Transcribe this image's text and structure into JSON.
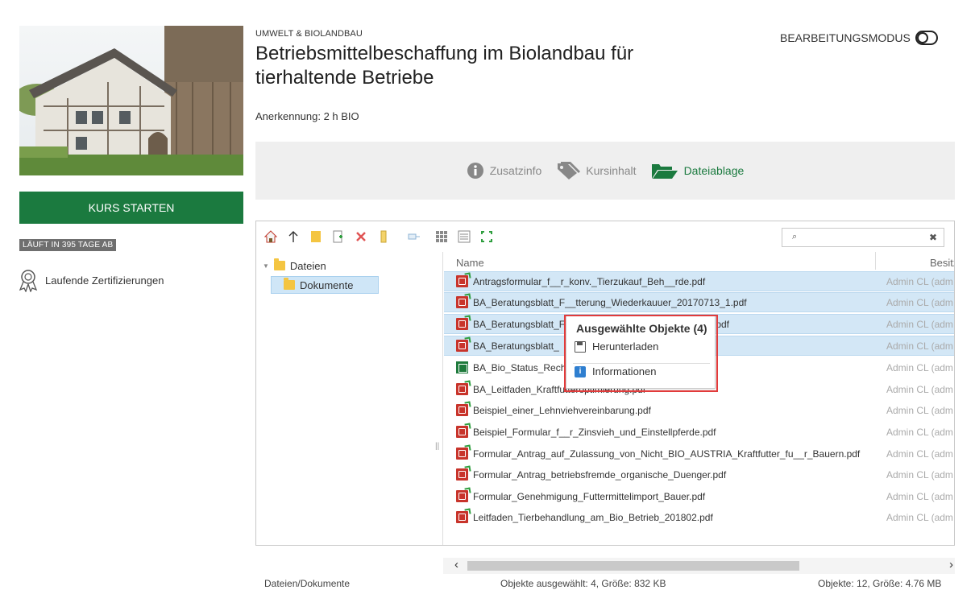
{
  "sidebar": {
    "start_button": "KURS STARTEN",
    "runs_badge": "LÄUFT IN 395 TAGE AB",
    "certifications_label": "Laufende Zertifizierungen"
  },
  "header": {
    "category": "UMWELT & BIOLANDBAU",
    "title": "Betriebsmittelbeschaffung im Biolandbau für tierhaltende Betriebe",
    "recognition": "Anerkennung: 2 h BIO",
    "edit_mode_label": "BEARBEITUNGSMODUS"
  },
  "tabs": [
    {
      "label": "Zusatzinfo",
      "icon": "info-circle-icon",
      "active": false
    },
    {
      "label": "Kursinhalt",
      "icon": "tags-icon",
      "active": false
    },
    {
      "label": "Dateiablage",
      "icon": "folder-open-icon",
      "active": true
    }
  ],
  "file_manager": {
    "search_placeholder": "",
    "tree": {
      "root": "Dateien",
      "child": "Dokumente"
    },
    "columns": {
      "name": "Name",
      "owner": "Besitz"
    },
    "files": [
      {
        "name": "Antragsformular_f__r_konv._Tierzukauf_Beh__rde.pdf",
        "owner": "Admin CL (adm",
        "type": "pdf",
        "selected": true
      },
      {
        "name": "BA_Beratungsblatt_F__tterung_Wiederkauuer_20170713_1.pdf",
        "owner": "Admin CL (adm",
        "type": "pdf",
        "selected": true
      },
      {
        "name": "BA_Beratungsblatt_F",
        "name_tail": ".pdf",
        "owner": "Admin CL (adm",
        "type": "pdf",
        "selected": true
      },
      {
        "name": "BA_Beratungsblatt_",
        "owner": "Admin CL (adm",
        "type": "pdf",
        "selected": true
      },
      {
        "name": "BA_Bio_Status_Rechr",
        "owner": "Admin CL (adm",
        "type": "xls",
        "selected": false
      },
      {
        "name": "BA_Leitfaden_Kraftfutteroptimierung.pdf",
        "owner": "Admin CL (adm",
        "type": "pdf",
        "selected": false
      },
      {
        "name": "Beispiel_einer_Lehnviehvereinbarung.pdf",
        "owner": "Admin CL (adm",
        "type": "pdf",
        "selected": false
      },
      {
        "name": "Beispiel_Formular_f__r_Zinsvieh_und_Einstellpferde.pdf",
        "owner": "Admin CL (adm",
        "type": "pdf",
        "selected": false
      },
      {
        "name": "Formular_Antrag_auf_Zulassung_von_Nicht_BIO_AUSTRIA_Kraftfutter_fu__r_Bauern.pdf",
        "owner": "Admin CL (adm",
        "type": "pdf",
        "selected": false
      },
      {
        "name": "Formular_Antrag_betriebsfremde_organische_Duenger.pdf",
        "owner": "Admin CL (adm",
        "type": "pdf",
        "selected": false
      },
      {
        "name": "Formular_Genehmigung_Futtermittelimport_Bauer.pdf",
        "owner": "Admin CL (adm",
        "type": "pdf",
        "selected": false
      },
      {
        "name": "Leitfaden_Tierbehandlung_am_Bio_Betrieb_201802.pdf",
        "owner": "Admin CL (adm",
        "type": "pdf",
        "selected": false
      }
    ],
    "context_menu": {
      "title": "Ausgewählte Objekte (4)",
      "download": "Herunterladen",
      "info": "Informationen"
    },
    "status": {
      "path": "Dateien/Dokumente",
      "selected": "Objekte ausgewählt: 4, Größe: 832 KB",
      "total": "Objekte: 12, Größe: 4.76 MB"
    }
  },
  "colors": {
    "brand_green": "#1b7a3f",
    "selection_blue": "#d3e7f6",
    "highlight_red": "#e23b3b"
  }
}
